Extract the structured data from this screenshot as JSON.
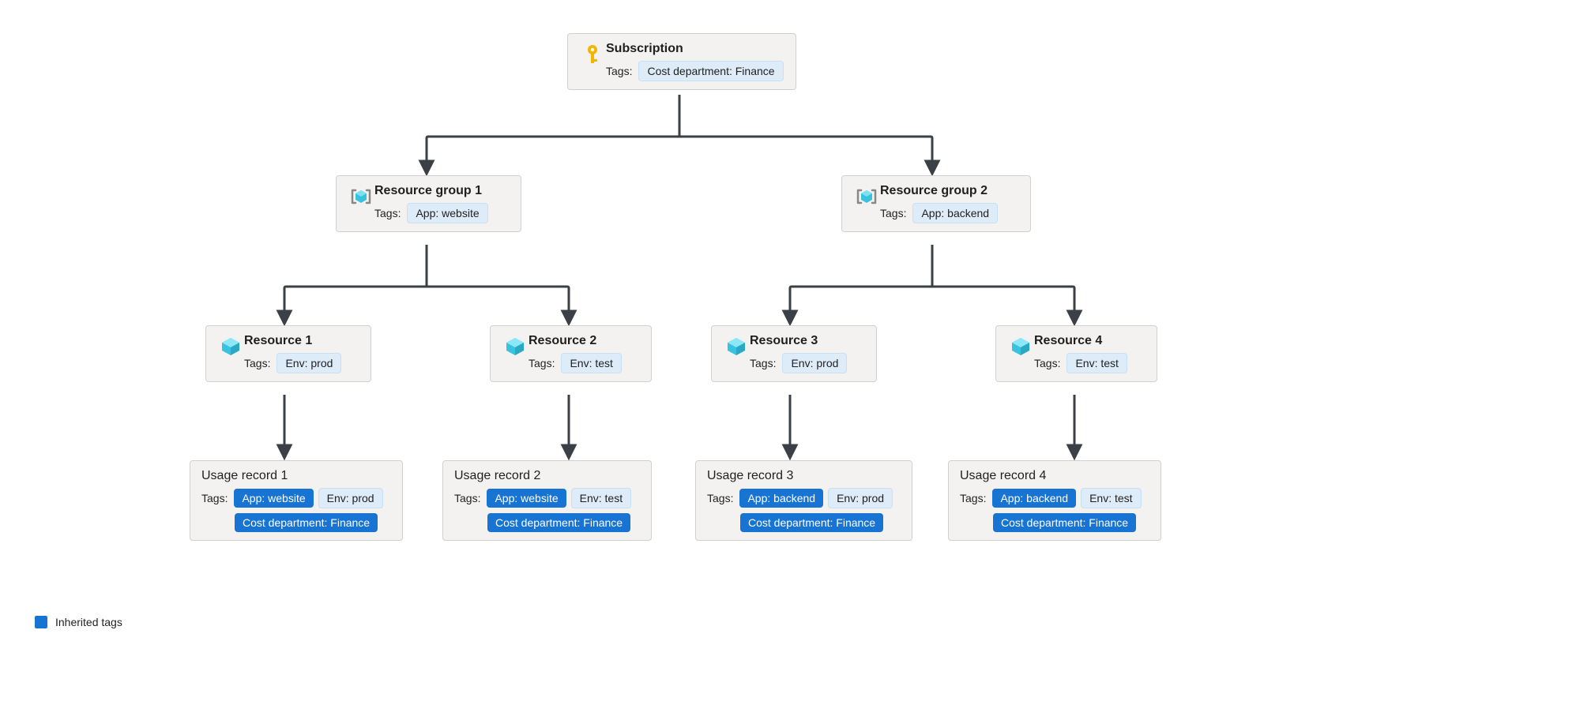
{
  "labels": {
    "tags": "Tags:"
  },
  "subscription": {
    "title": "Subscription",
    "tag": "Cost department: Finance"
  },
  "resource_groups": [
    {
      "title": "Resource group 1",
      "tag": "App: website"
    },
    {
      "title": "Resource group 2",
      "tag": "App: backend"
    }
  ],
  "resources": [
    {
      "title": "Resource 1",
      "tag": "Env: prod"
    },
    {
      "title": "Resource 2",
      "tag": "Env: test"
    },
    {
      "title": "Resource 3",
      "tag": "Env: prod"
    },
    {
      "title": "Resource 4",
      "tag": "Env: test"
    }
  ],
  "usage": [
    {
      "title": "Usage record 1",
      "inherited": [
        "App: website",
        "Cost department: Finance"
      ],
      "own": "Env: prod"
    },
    {
      "title": "Usage record 2",
      "inherited": [
        "App: website",
        "Cost department: Finance"
      ],
      "own": "Env: test"
    },
    {
      "title": "Usage record 3",
      "inherited": [
        "App: backend",
        "Cost department: Finance"
      ],
      "own": "Env: prod"
    },
    {
      "title": "Usage record 4",
      "inherited": [
        "App: backend",
        "Cost department: Finance"
      ],
      "own": "Env: test"
    }
  ],
  "legend": {
    "label": "Inherited tags"
  },
  "colors": {
    "inherited_tag_bg": "#1874d2",
    "light_tag_bg": "#deecf9",
    "node_bg": "#f3f2f1",
    "connector": "#3b4047"
  }
}
